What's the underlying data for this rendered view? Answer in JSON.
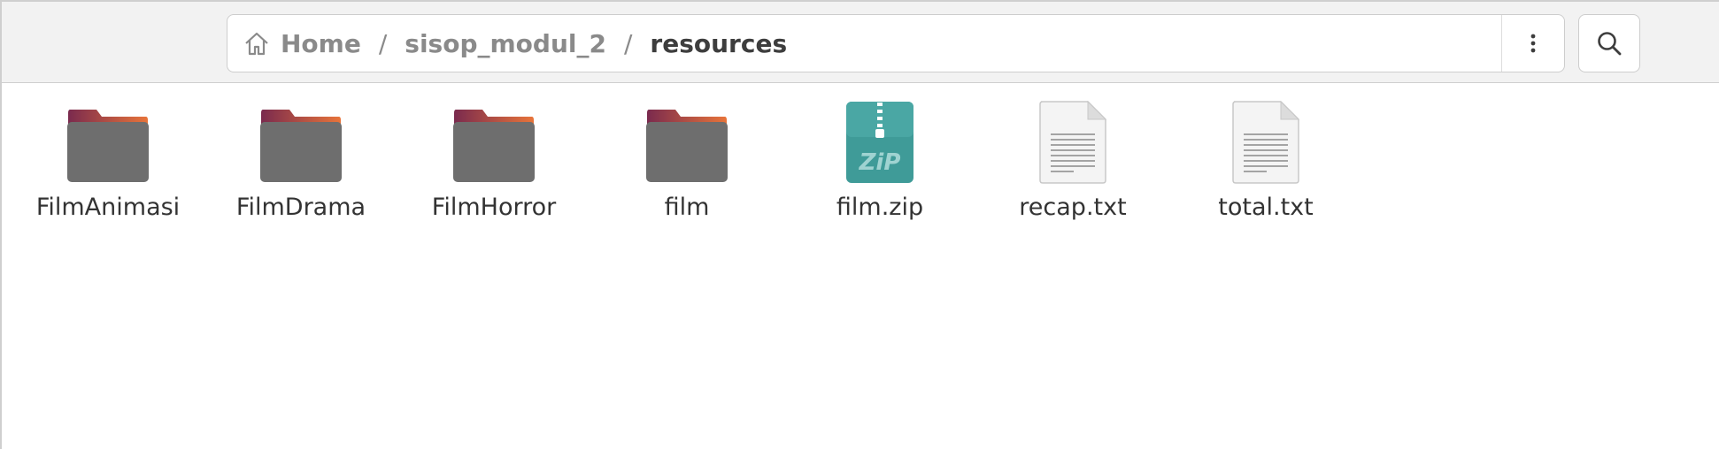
{
  "pathbar": {
    "crumbs": [
      {
        "label": "Home",
        "icon": "home-icon"
      },
      {
        "label": "sisop_modul_2"
      },
      {
        "label": "resources"
      }
    ],
    "separator": "/"
  },
  "toolbar": {
    "menu_icon": "vertical-dots-icon",
    "search_icon": "search-icon"
  },
  "files": [
    {
      "name": "FilmAnimasi",
      "type": "folder",
      "icon": "folder-icon"
    },
    {
      "name": "FilmDrama",
      "type": "folder",
      "icon": "folder-icon"
    },
    {
      "name": "FilmHorror",
      "type": "folder",
      "icon": "folder-icon"
    },
    {
      "name": "film",
      "type": "folder",
      "icon": "folder-icon"
    },
    {
      "name": "film.zip",
      "type": "archive",
      "icon": "zip-archive-icon"
    },
    {
      "name": "recap.txt",
      "type": "text",
      "icon": "text-file-icon"
    },
    {
      "name": "total.txt",
      "type": "text",
      "icon": "text-file-icon"
    }
  ],
  "colors": {
    "folder_body": "#6e6e6e",
    "folder_tab_start": "#7a2a4e",
    "folder_tab_end": "#e8743a",
    "zip_body": "#3f9b98",
    "text_file": "#f4f4f4"
  }
}
